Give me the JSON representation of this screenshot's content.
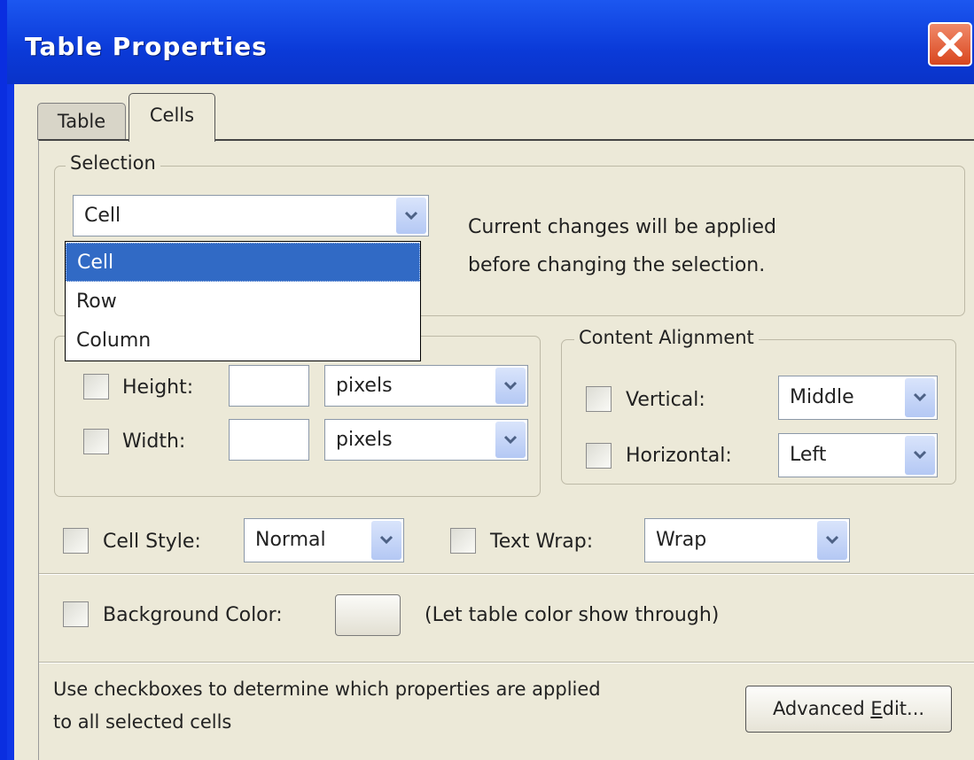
{
  "window": {
    "title": "Table Properties"
  },
  "tabs": [
    {
      "label": "Table"
    },
    {
      "label": "Cells"
    }
  ],
  "selection": {
    "legend": "Selection",
    "value": "Cell",
    "options": [
      "Cell",
      "Row",
      "Column"
    ],
    "note_line1": "Current changes will be applied",
    "note_line2": "before changing the selection."
  },
  "size": {
    "height_label": "Height:",
    "height_value": "",
    "height_unit": "pixels",
    "width_label": "Width:",
    "width_value": "",
    "width_unit": "pixels"
  },
  "alignment": {
    "legend": "Content Alignment",
    "vertical_label": "Vertical:",
    "vertical_value": "Middle",
    "horizontal_label": "Horizontal:",
    "horizontal_value": "Left"
  },
  "cell_style": {
    "label": "Cell Style:",
    "value": "Normal"
  },
  "text_wrap": {
    "label": "Text Wrap:",
    "value": "Wrap"
  },
  "background": {
    "label": "Background Color:",
    "note": "(Let table color show through)"
  },
  "footer": {
    "hint_line1": "Use checkboxes to determine which properties are applied",
    "hint_line2": "to all selected cells",
    "advanced_pre": "Advanced ",
    "advanced_underline": "E",
    "advanced_post": "dit..."
  },
  "icons": {
    "close": "close-icon",
    "dropdown": "chevron-down-icon"
  },
  "colors": {
    "titlebar": "#0b3ad8",
    "dialog_bg": "#ece9d8",
    "selection_highlight": "#316ac5",
    "close_button": "#d9461e"
  }
}
